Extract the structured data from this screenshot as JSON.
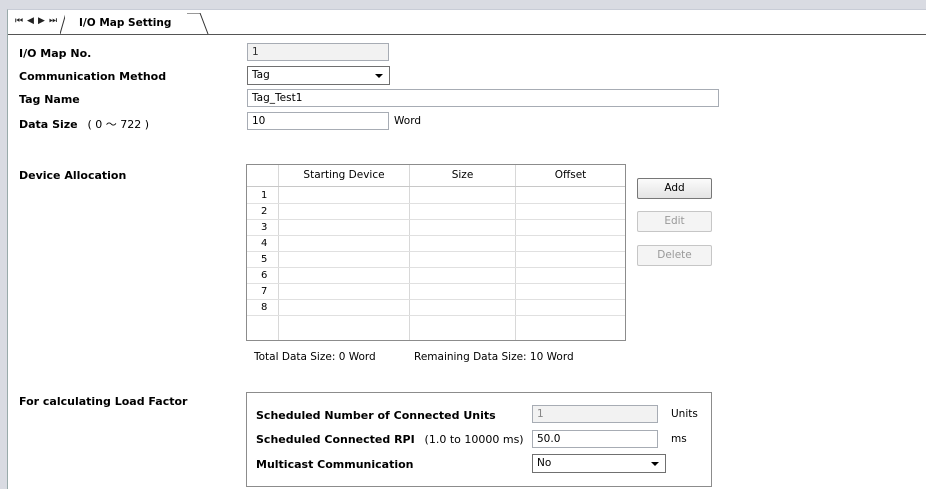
{
  "tabbar": {
    "nav": [
      "⏮",
      "◀",
      "▶",
      "⏭"
    ],
    "tab_label": "I/O Map Setting"
  },
  "form": {
    "io_map_no": {
      "label": "I/O Map No.",
      "value": "1"
    },
    "comm_method": {
      "label": "Communication Method",
      "value": "Tag"
    },
    "tag_name": {
      "label": "Tag Name",
      "value": "Tag_Test1"
    },
    "data_size": {
      "label": "Data Size",
      "range": "( 0 〜 722 )",
      "value": "10",
      "unit": "Word"
    }
  },
  "device_allocation": {
    "label": "Device Allocation",
    "columns": [
      "Starting Device",
      "Size",
      "Offset"
    ],
    "row_numbers": [
      "1",
      "2",
      "3",
      "4",
      "5",
      "6",
      "7",
      "8"
    ],
    "buttons": {
      "add": "Add",
      "edit": "Edit",
      "delete": "Delete"
    },
    "total": "Total Data Size: 0 Word",
    "remaining": "Remaining Data Size: 10 Word"
  },
  "load_factor": {
    "label": "For calculating Load Factor",
    "units": {
      "label": "Scheduled Number of Connected Units",
      "value": "1",
      "unit": "Units"
    },
    "rpi": {
      "label": "Scheduled Connected RPI",
      "range": "(1.0 to 10000 ms)",
      "value": "50.0",
      "unit": "ms"
    },
    "multicast": {
      "label": "Multicast Communication",
      "value": "No"
    }
  }
}
